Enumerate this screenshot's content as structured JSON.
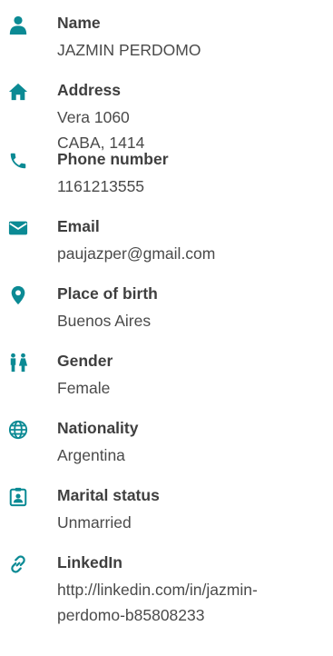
{
  "accent_color": "#0b8a94",
  "fields": [
    {
      "icon": "person-icon",
      "label": "Name",
      "lines": [
        "JAZMIN PERDOMO"
      ]
    },
    {
      "icon": "home-icon",
      "label": "Address",
      "lines": [
        "Vera 1060",
        "CABA, 1414"
      ]
    },
    {
      "icon": "phone-icon",
      "label": "Phone number",
      "lines": [
        "1161213555"
      ]
    },
    {
      "icon": "email-icon",
      "label": "Email",
      "lines": [
        "paujazper@gmail.com"
      ]
    },
    {
      "icon": "location-pin-icon",
      "label": "Place of birth",
      "lines": [
        "Buenos Aires"
      ]
    },
    {
      "icon": "gender-icon",
      "label": "Gender",
      "lines": [
        "Female"
      ]
    },
    {
      "icon": "globe-icon",
      "label": "Nationality",
      "lines": [
        "Argentina"
      ]
    },
    {
      "icon": "id-badge-icon",
      "label": "Marital status",
      "lines": [
        "Unmarried"
      ]
    },
    {
      "icon": "link-icon",
      "label": "LinkedIn",
      "lines": [
        "http://linkedin.com/in/jazmin-",
        "perdomo-b85808233"
      ]
    }
  ]
}
